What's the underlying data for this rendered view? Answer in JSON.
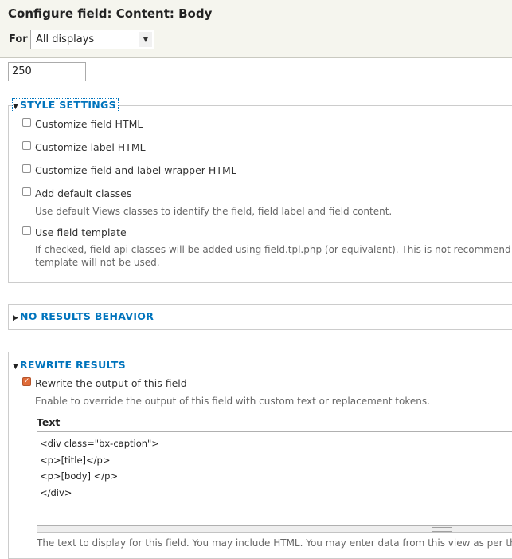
{
  "dialog": {
    "title": "Configure field: Content: Body",
    "for_label": "For",
    "display_select": {
      "selected": "All displays"
    }
  },
  "trim": {
    "max_length_value": "250"
  },
  "style_settings": {
    "legend": "STYLE SETTINGS",
    "options": [
      {
        "label": "Customize field HTML",
        "checked": false
      },
      {
        "label": "Customize label HTML",
        "checked": false
      },
      {
        "label": "Customize field and label wrapper HTML",
        "checked": false
      },
      {
        "label": "Add default classes",
        "checked": false,
        "description": "Use default Views classes to identify the field, field label and field content."
      },
      {
        "label": "Use field template",
        "checked": false,
        "description_line1": "If checked, field api classes will be added using field.tpl.php (or equivalent). This is not recommend",
        "description_line2": "template will not be used."
      }
    ]
  },
  "no_results": {
    "legend": "NO RESULTS BEHAVIOR"
  },
  "rewrite": {
    "legend": "REWRITE RESULTS",
    "rewrite_option": {
      "label": "Rewrite the output of this field",
      "checked": true
    },
    "rewrite_description": "Enable to override the output of this field with custom text or replacement tokens.",
    "text_label": "Text",
    "text_lines": [
      "<div class=\"bx-caption\">",
      "<p>[title]</p>",
      "<p>[body] </p>",
      "</div>"
    ],
    "text_help": "The text to display for this field. You may include HTML. You may enter data from this view as per th"
  }
}
